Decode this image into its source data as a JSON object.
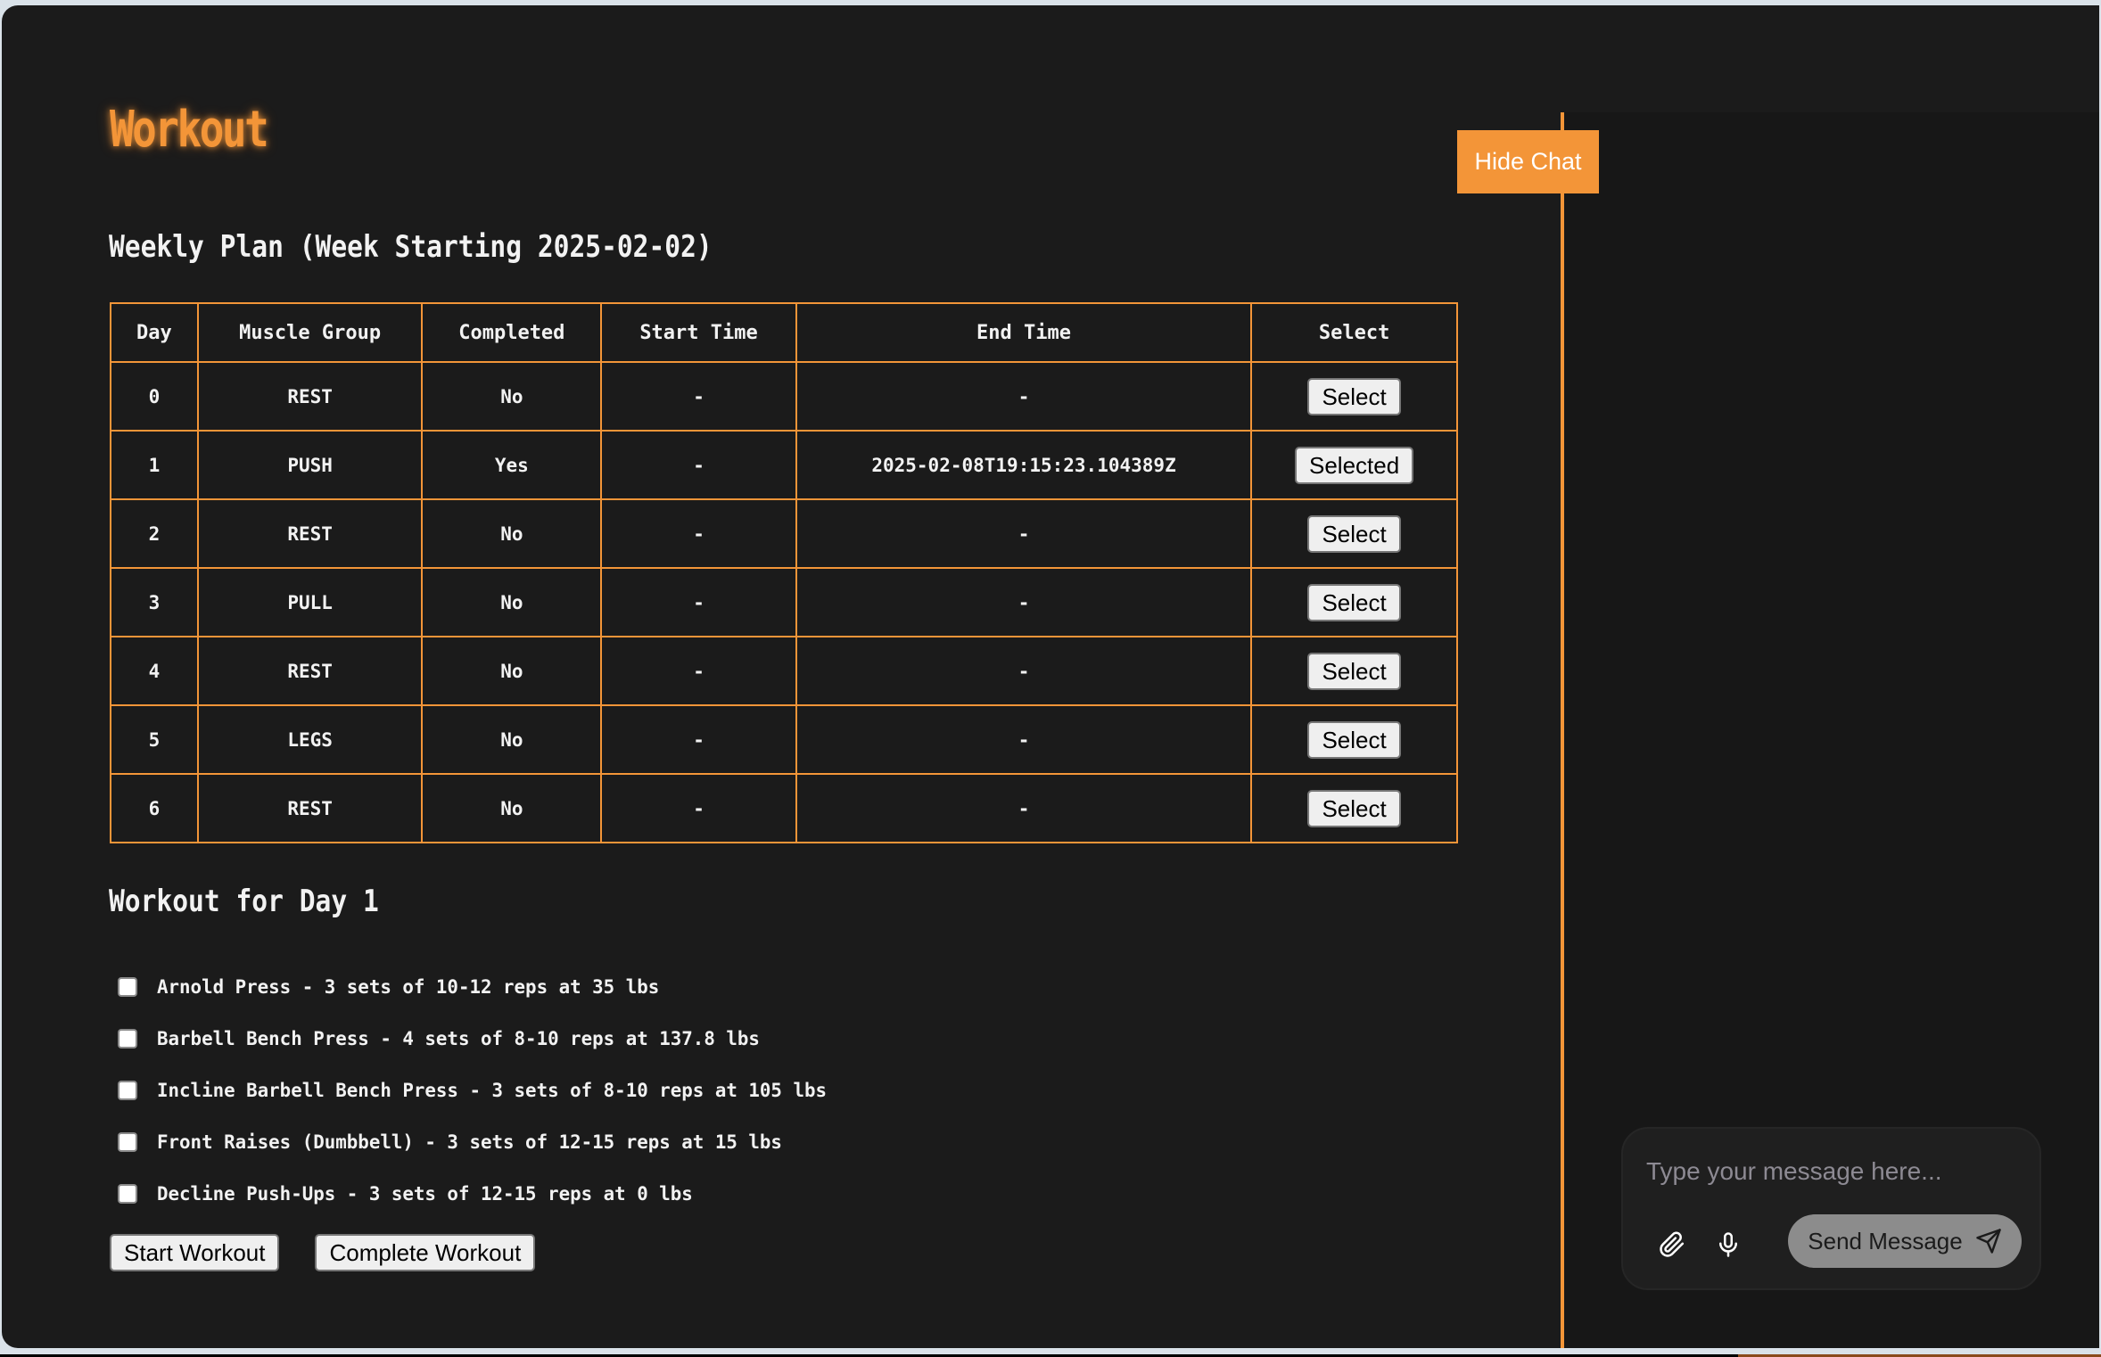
{
  "app": {
    "title": "Workout",
    "accent_color": "#f39538"
  },
  "weekly_plan": {
    "heading": "Weekly Plan (Week Starting 2025-02-02)",
    "columns": [
      "Day",
      "Muscle Group",
      "Completed",
      "Start Time",
      "End Time",
      "Select"
    ],
    "rows": [
      {
        "day": "0",
        "muscle_group": "REST",
        "completed": "No",
        "start_time": "-",
        "end_time": "-",
        "select_label": "Select"
      },
      {
        "day": "1",
        "muscle_group": "PUSH",
        "completed": "Yes",
        "start_time": "-",
        "end_time": "2025-02-08T19:15:23.104389Z",
        "select_label": "Selected"
      },
      {
        "day": "2",
        "muscle_group": "REST",
        "completed": "No",
        "start_time": "-",
        "end_time": "-",
        "select_label": "Select"
      },
      {
        "day": "3",
        "muscle_group": "PULL",
        "completed": "No",
        "start_time": "-",
        "end_time": "-",
        "select_label": "Select"
      },
      {
        "day": "4",
        "muscle_group": "REST",
        "completed": "No",
        "start_time": "-",
        "end_time": "-",
        "select_label": "Select"
      },
      {
        "day": "5",
        "muscle_group": "LEGS",
        "completed": "No",
        "start_time": "-",
        "end_time": "-",
        "select_label": "Select"
      },
      {
        "day": "6",
        "muscle_group": "REST",
        "completed": "No",
        "start_time": "-",
        "end_time": "-",
        "select_label": "Select"
      }
    ]
  },
  "day_workout": {
    "heading": "Workout for Day 1",
    "exercises": [
      {
        "label": "Arnold Press - 3 sets of 10-12 reps at 35 lbs",
        "checked": false
      },
      {
        "label": "Barbell Bench Press - 4 sets of 8-10 reps at 137.8 lbs",
        "checked": false
      },
      {
        "label": "Incline Barbell Bench Press - 3 sets of 8-10 reps at 105 lbs",
        "checked": false
      },
      {
        "label": "Front Raises (Dumbbell) - 3 sets of 12-15 reps at 15 lbs",
        "checked": false
      },
      {
        "label": "Decline Push-Ups - 3 sets of 12-15 reps at 0 lbs",
        "checked": false
      }
    ],
    "start_button": "Start Workout",
    "complete_button": "Complete Workout"
  },
  "chat": {
    "hide_button": "Hide Chat",
    "input_placeholder": "Type your message here...",
    "input_value": "",
    "attach_icon": "paperclip-icon",
    "mic_icon": "microphone-icon",
    "send_label": "Send Message",
    "send_icon": "send-icon"
  }
}
